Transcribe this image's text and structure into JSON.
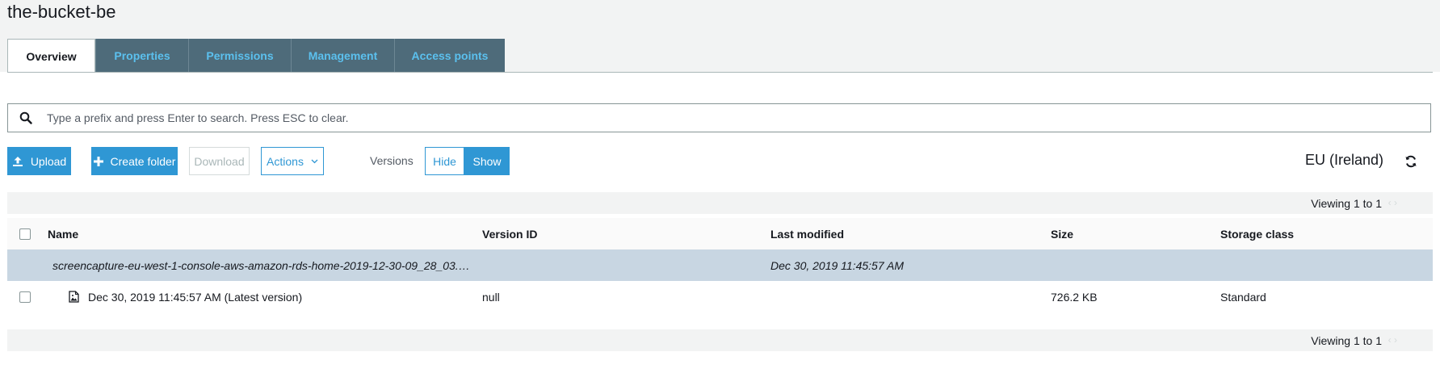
{
  "bucket": {
    "title": "the-bucket-be"
  },
  "tabs": [
    {
      "label": "Overview",
      "active": true
    },
    {
      "label": "Properties",
      "active": false
    },
    {
      "label": "Permissions",
      "active": false
    },
    {
      "label": "Management",
      "active": false
    },
    {
      "label": "Access points",
      "active": false
    }
  ],
  "search": {
    "placeholder": "Type a prefix and press Enter to search. Press ESC to clear.",
    "value": ""
  },
  "toolbar": {
    "upload_label": "Upload",
    "create_folder_label": "Create folder",
    "download_label": "Download",
    "actions_label": "Actions",
    "versions_label": "Versions",
    "hide_label": "Hide",
    "show_label": "Show",
    "region": "EU (Ireland)"
  },
  "pagination": {
    "top": "Viewing 1 to 1",
    "bottom": "Viewing 1 to 1"
  },
  "table": {
    "columns": [
      "Name",
      "Version ID",
      "Last modified",
      "Size",
      "Storage class"
    ],
    "group_row": {
      "name": "screencapture-eu-west-1-console-aws-amazon-rds-home-2019-12-30-09_28_03.…",
      "last_modified": "Dec 30, 2019 11:45:57 AM"
    },
    "version_row": {
      "name": "Dec 30, 2019 11:45:57 AM (Latest version)",
      "version_id": "null",
      "size": "726.2 KB",
      "storage_class": "Standard"
    }
  },
  "icons": {
    "search": "search-icon",
    "upload": "upload-icon",
    "create_folder": "plus-icon",
    "actions": "chevron-down-icon",
    "refresh": "refresh-icon",
    "file": "image-file-icon"
  },
  "colors": {
    "accent": "#2f97d4",
    "tab_bg": "#4e6b7a",
    "tab_text": "#5bc0ee",
    "selected_row": "#c8d6e2"
  }
}
